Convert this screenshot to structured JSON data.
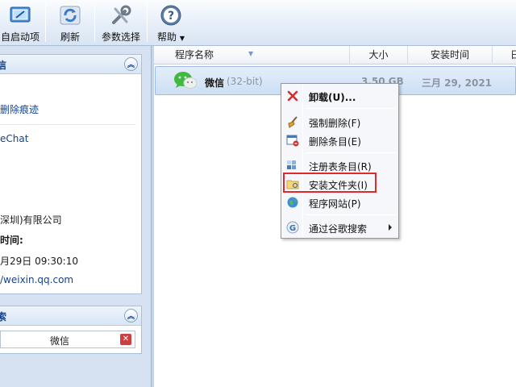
{
  "toolbar": {
    "buttons": [
      {
        "label": "自启动项",
        "icon": "startup-icon"
      },
      {
        "label": "刷新",
        "icon": "refresh-icon"
      },
      {
        "label": "参数选择",
        "icon": "tools-icon"
      },
      {
        "label": "帮助",
        "icon": "help-icon"
      }
    ]
  },
  "left_panel": {
    "details_group": {
      "title": "信",
      "items": [
        {
          "text": "删除痕迹"
        },
        {
          "text": "eChat"
        },
        {
          "text": "深圳)有限公司"
        },
        {
          "text": "时间:"
        },
        {
          "text": "月29日 09:30:10"
        },
        {
          "text": "/weixin.qq.com"
        }
      ]
    },
    "search_group": {
      "title": "索",
      "value": "微信"
    }
  },
  "list": {
    "columns": [
      "程序名称",
      "大小",
      "安装时间",
      "日"
    ],
    "rows": [
      {
        "name": "微信",
        "arch": "(32-bit)",
        "size": "3.50 GB",
        "date": "三月 29, 2021"
      }
    ]
  },
  "context_menu": {
    "items": [
      {
        "label": "卸载(U)...",
        "icon": "red-x-icon"
      },
      {
        "label": "强制删除(F)",
        "icon": "broom-icon"
      },
      {
        "label": "删除条目(E)",
        "icon": "window-delete-icon"
      },
      {
        "label": "注册表条目(R)",
        "icon": "registry-icon"
      },
      {
        "label": "安装文件夹(I)",
        "icon": "folder-icon"
      },
      {
        "label": "程序网站(P)",
        "icon": "globe-icon"
      },
      {
        "label": "通过谷歌搜索",
        "icon": "google-icon"
      }
    ]
  },
  "colors": {
    "highlight_box": "#e0282e",
    "link": "#15428b",
    "selected_row": "#cddff4"
  }
}
